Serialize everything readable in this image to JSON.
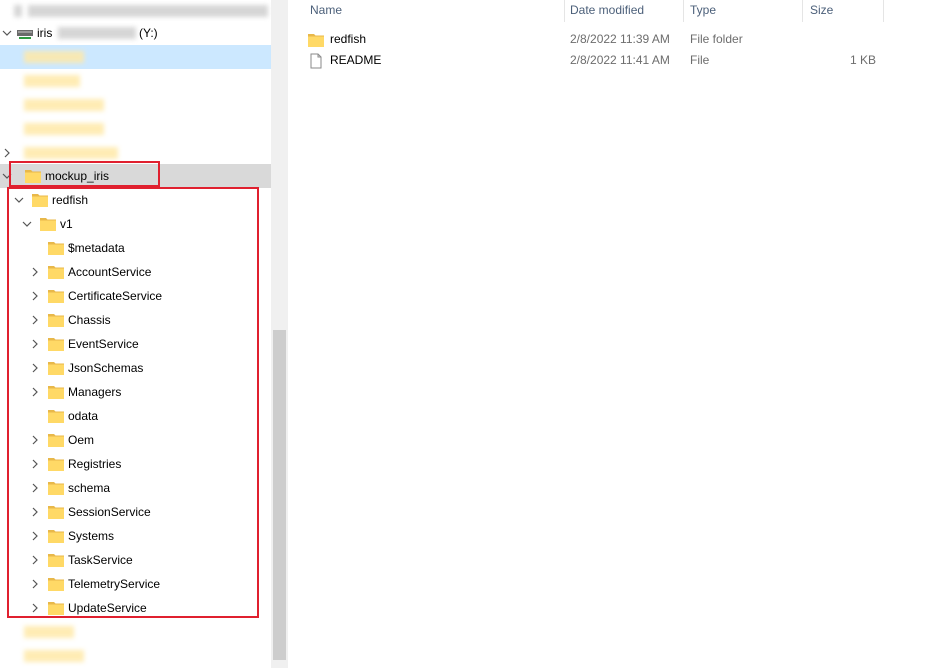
{
  "nav": {
    "drive_label": "iris",
    "drive_letter": "(Y:)",
    "mockup_label": "mockup_iris",
    "tree": [
      {
        "label": "redfish",
        "expanded": true,
        "has_children": true
      },
      {
        "label": "v1",
        "expanded": true,
        "has_children": true
      },
      {
        "label": "$metadata",
        "has_children": false
      },
      {
        "label": "AccountService",
        "has_children": true
      },
      {
        "label": "CertificateService",
        "has_children": true
      },
      {
        "label": "Chassis",
        "has_children": true
      },
      {
        "label": "EventService",
        "has_children": true
      },
      {
        "label": "JsonSchemas",
        "has_children": true
      },
      {
        "label": "Managers",
        "has_children": true
      },
      {
        "label": "odata",
        "has_children": false
      },
      {
        "label": "Oem",
        "has_children": true
      },
      {
        "label": "Registries",
        "has_children": true
      },
      {
        "label": "schema",
        "has_children": true
      },
      {
        "label": "SessionService",
        "has_children": true
      },
      {
        "label": "Systems",
        "has_children": true
      },
      {
        "label": "TaskService",
        "has_children": true
      },
      {
        "label": "TelemetryService",
        "has_children": true
      },
      {
        "label": "UpdateService",
        "has_children": true
      }
    ]
  },
  "content": {
    "columns": {
      "name": "Name",
      "date": "Date modified",
      "type": "Type",
      "size": "Size"
    },
    "files": [
      {
        "name": "redfish",
        "date": "2/8/2022 11:39 AM",
        "type": "File folder",
        "size": "",
        "icon": "folder-icon"
      },
      {
        "name": "README",
        "date": "2/8/2022 11:41 AM",
        "type": "File",
        "size": "1 KB",
        "icon": "file-icon"
      }
    ]
  },
  "colors": {
    "folder": "#ffd966",
    "highlight": "#e0202f",
    "selected": "#cce8ff",
    "hover": "#d9d9d9",
    "header_text": "#4c607a"
  }
}
